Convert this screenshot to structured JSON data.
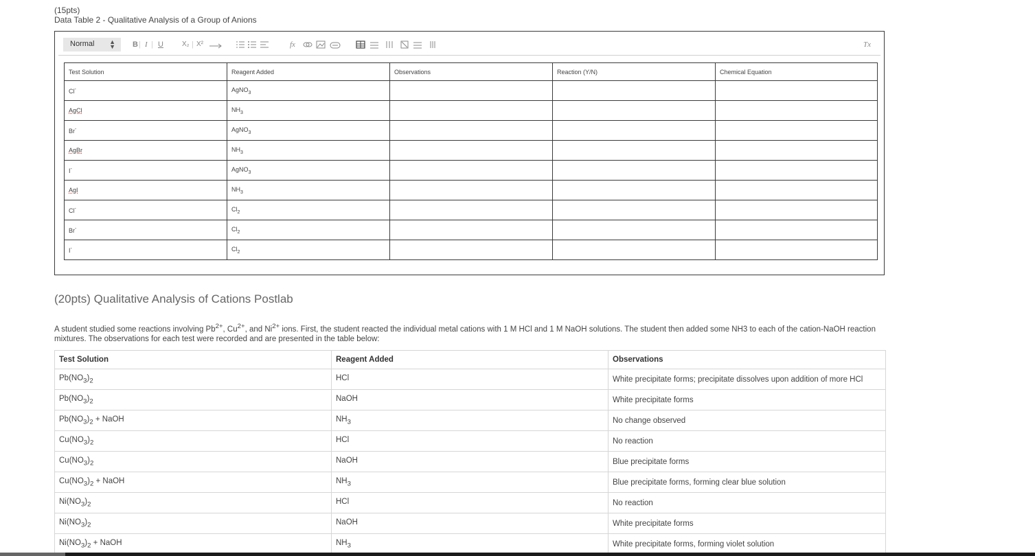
{
  "header": {
    "points": "(15pts)",
    "title": "Data Table 2 - Qualitative Analysis of a Group of Anions"
  },
  "editor": {
    "style_select": "Normal",
    "toolbar": {
      "bold": "B",
      "italic": "I",
      "underline": "U",
      "subscript": "X₂",
      "superscript": "X²",
      "formula": "fx",
      "clear_format": "Tx"
    },
    "table": {
      "headers": [
        "Test Solution",
        "Reagent Added",
        "Observations",
        "Reaction (Y/N)",
        "Chemical Equation"
      ],
      "rows": [
        {
          "solution": "Cl",
          "sup": "-",
          "reagent": "AgNO",
          "reagent_sub": "3"
        },
        {
          "solution": "AgCl",
          "sup": "",
          "reagent": "NH",
          "reagent_sub": "3"
        },
        {
          "solution": "Br",
          "sup": "-",
          "reagent": "AgNO",
          "reagent_sub": "3"
        },
        {
          "solution": "AgBr",
          "sup": "",
          "reagent": "NH",
          "reagent_sub": "3"
        },
        {
          "solution": "I",
          "sup": "-",
          "reagent": "AgNO",
          "reagent_sub": "3"
        },
        {
          "solution": "AgI",
          "sup": "",
          "reagent": "NH",
          "reagent_sub": "3"
        },
        {
          "solution": "Cl",
          "sup": "-",
          "reagent": "Cl",
          "reagent_sub": "2"
        },
        {
          "solution": "Br",
          "sup": "-",
          "reagent": "Cl",
          "reagent_sub": "2"
        },
        {
          "solution": "I",
          "sup": "-",
          "reagent": "Cl",
          "reagent_sub": "2"
        }
      ]
    }
  },
  "section2": {
    "title": "(20pts) Qualitative Analysis of Cations Postlab",
    "intro_parts": {
      "p1": "A student studied some reactions involving Pb",
      "s1": "2+",
      "p2": ", Cu",
      "s2": "2+",
      "p3": ", and Ni",
      "s3": "2+",
      "p4": " ions. First, the student reacted the individual metal cations with 1 M HCl and 1 M NaOH solutions. The student then added some NH3 to each of the cation-NaOH reaction mixtures. The observations for each test were recorded and are presented in the table below:"
    },
    "table": {
      "headers": [
        "Test Solution",
        "Reagent Added",
        "Observations"
      ],
      "rows": [
        {
          "metal": "Pb",
          "suffix": "",
          "reagent": "HCl",
          "reagent_sub": "",
          "obs": "White precipitate forms; precipitate dissolves upon addition of more HCl"
        },
        {
          "metal": "Pb",
          "suffix": "",
          "reagent": "NaOH",
          "reagent_sub": "",
          "obs": "White precipitate forms"
        },
        {
          "metal": "Pb",
          "suffix": " + NaOH",
          "reagent": "NH",
          "reagent_sub": "3",
          "obs": "No change observed"
        },
        {
          "metal": "Cu",
          "suffix": "",
          "reagent": "HCl",
          "reagent_sub": "",
          "obs": "No reaction"
        },
        {
          "metal": "Cu",
          "suffix": "",
          "reagent": "NaOH",
          "reagent_sub": "",
          "obs": "Blue precipitate forms"
        },
        {
          "metal": "Cu",
          "suffix": " + NaOH",
          "reagent": "NH",
          "reagent_sub": "3",
          "obs": "Blue precipitate forms, forming clear blue solution"
        },
        {
          "metal": "Ni",
          "suffix": "",
          "reagent": "HCl",
          "reagent_sub": "",
          "obs": "No reaction"
        },
        {
          "metal": "Ni",
          "suffix": "",
          "reagent": "NaOH",
          "reagent_sub": "",
          "obs": "White precipitate forms"
        },
        {
          "metal": "Ni",
          "suffix": " + NaOH",
          "reagent": "NH",
          "reagent_sub": "3",
          "obs": "White precipitate forms, forming violet solution"
        }
      ]
    }
  }
}
